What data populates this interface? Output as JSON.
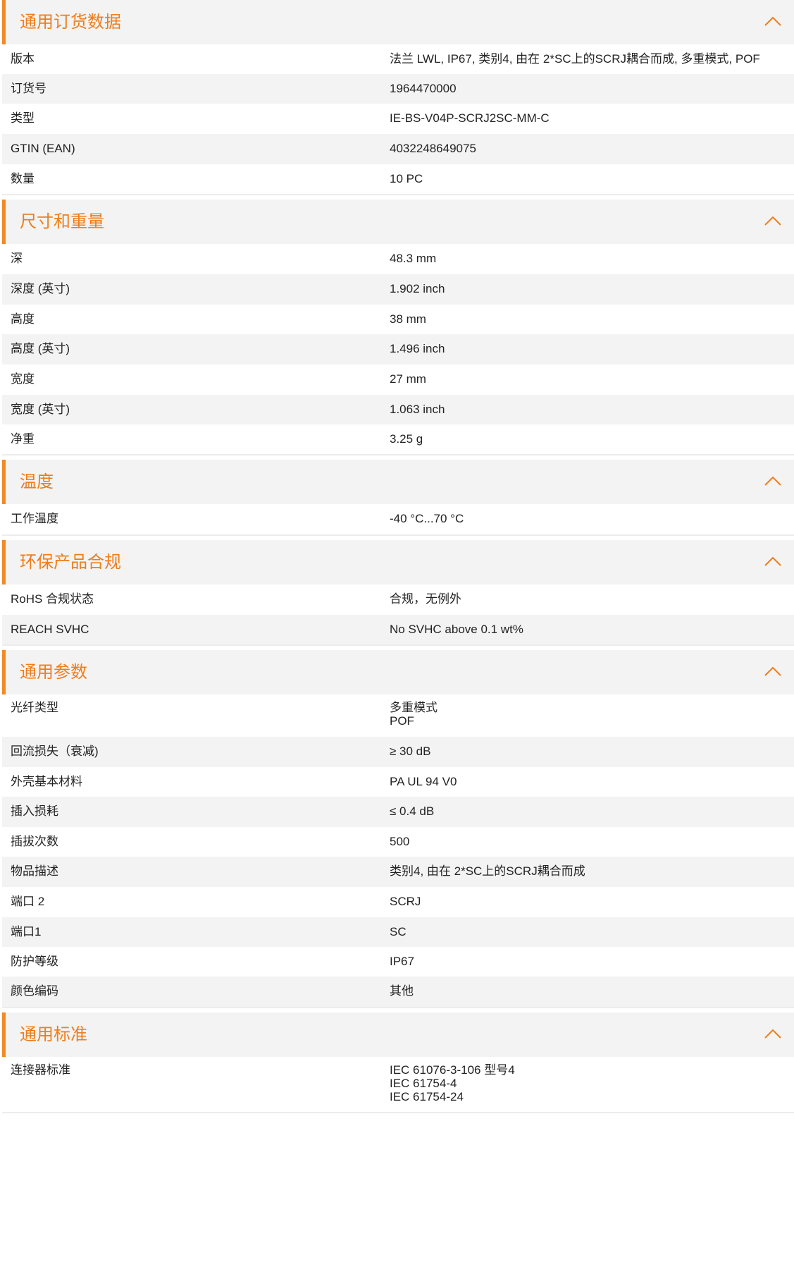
{
  "accent_color": "#ef7d1a",
  "chevron_icon": "chevron-up-icon",
  "sections": [
    {
      "title": "通用订货数据",
      "rows": [
        {
          "label": "版本",
          "value": "法兰 LWL, IP67, 类别4, 由在 2*SC上的SCRJ耦合而成, 多重模式, POF"
        },
        {
          "label": "订货号",
          "value": "1964470000"
        },
        {
          "label": "类型",
          "value": "IE-BS-V04P-SCRJ2SC-MM-C"
        },
        {
          "label": "GTIN (EAN)",
          "value": "4032248649075"
        },
        {
          "label": "数量",
          "value": "10  PC"
        }
      ]
    },
    {
      "title": "尺寸和重量",
      "rows": [
        {
          "label": "深",
          "value": "48.3  mm"
        },
        {
          "label": "深度 (英寸)",
          "value": "1.902  inch"
        },
        {
          "label": "高度",
          "value": "38  mm"
        },
        {
          "label": "高度 (英寸)",
          "value": "1.496  inch"
        },
        {
          "label": "宽度",
          "value": "27  mm"
        },
        {
          "label": "宽度 (英寸)",
          "value": "1.063  inch"
        },
        {
          "label": "净重",
          "value": "3.25  g"
        }
      ]
    },
    {
      "title": "温度",
      "rows": [
        {
          "label": "工作温度",
          "value": "-40 °C...70 °C"
        }
      ]
    },
    {
      "title": "环保产品合规",
      "rows": [
        {
          "label": "RoHS 合规状态",
          "value": "合规，无例外"
        },
        {
          "label": "REACH SVHC",
          "value": "No SVHC above 0.1 wt%"
        }
      ]
    },
    {
      "title": "通用参数",
      "rows": [
        {
          "label": "光纤类型",
          "value": [
            "多重模式",
            "POF"
          ]
        },
        {
          "label": "回流损失（衰减)",
          "value": "≥ 30 dB"
        },
        {
          "label": "外壳基本材料",
          "value": "PA UL 94 V0"
        },
        {
          "label": "插入损耗",
          "value": "≤ 0.4 dB"
        },
        {
          "label": "插拔次数",
          "value": "500"
        },
        {
          "label": "物品描述",
          "value": "类别4, 由在 2*SC上的SCRJ耦合而成"
        },
        {
          "label": "端口 2",
          "value": "SCRJ"
        },
        {
          "label": "端口1",
          "value": "SC"
        },
        {
          "label": "防护等级",
          "value": "IP67"
        },
        {
          "label": "颜色编码",
          "value": "其他"
        }
      ]
    },
    {
      "title": "通用标准",
      "rows": [
        {
          "label": "连接器标准",
          "value": [
            "IEC 61076-3-106 型号4",
            "IEC 61754-4",
            "IEC 61754-24"
          ]
        }
      ]
    }
  ]
}
